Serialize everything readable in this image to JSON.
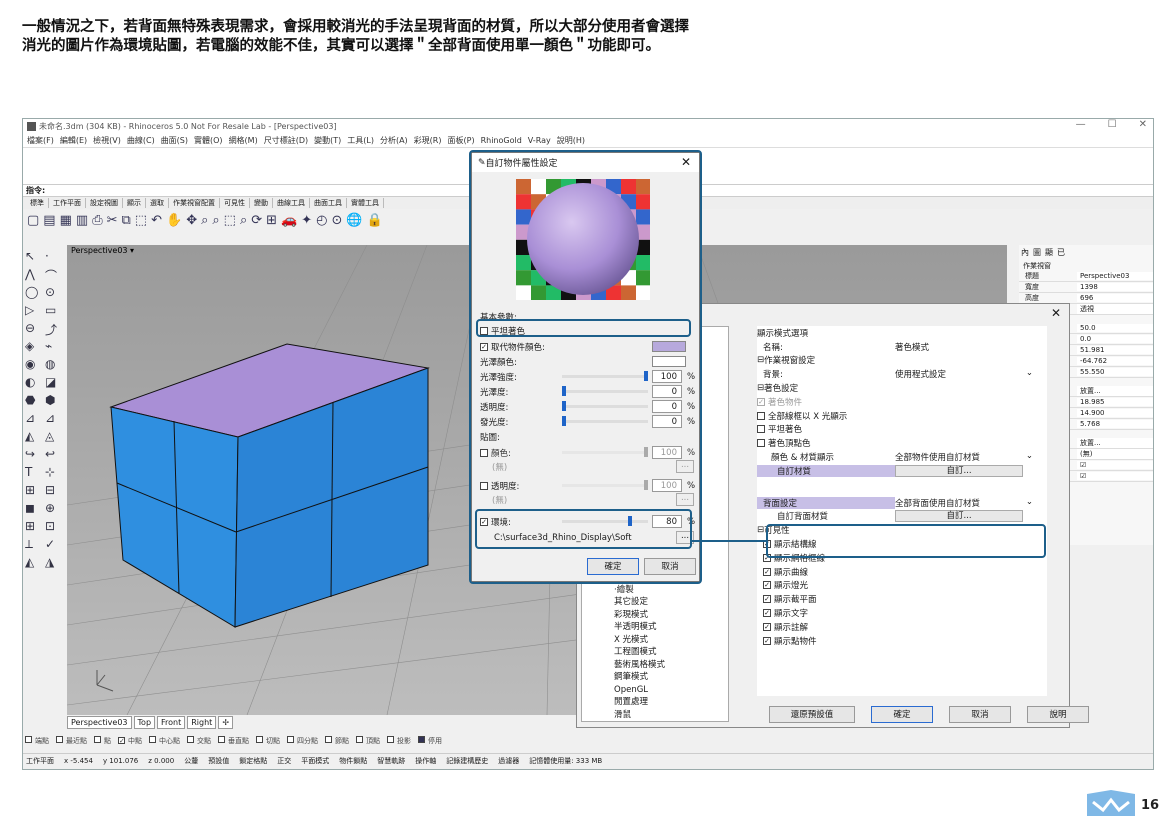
{
  "intro": {
    "line1": "一般情況之下，若背面無特殊表現需求，會採用較消光的手法呈現背面的材質，所以大部分使用者會選擇",
    "line2": "消光的圖片作為環境貼圖，若電腦的效能不佳，其實可以選擇＂全部背面使用單一顏色＂功能即可。"
  },
  "window": {
    "title": "未命名.3dm (304 KB) - Rhinoceros 5.0 Not For Resale Lab - [Perspective03]",
    "controls": [
      "—",
      "☐",
      "✕"
    ],
    "menus": [
      "檔案(F)",
      "編輯(E)",
      "檢視(V)",
      "曲線(C)",
      "曲面(S)",
      "實體(O)",
      "網格(M)",
      "尺寸標註(D)",
      "變動(T)",
      "工具(L)",
      "分析(A)",
      "彩現(R)",
      "面板(P)",
      "RhinoGold",
      "V-Ray",
      "說明(H)"
    ],
    "command_label": "指令:",
    "tool_tabs": [
      "標準",
      "工作平面",
      "設定視圖",
      "顯示",
      "選取",
      "作業視窗配置",
      "可見性",
      "變動",
      "曲線工具",
      "曲面工具",
      "實體工具"
    ],
    "toolbar_icons": [
      "▢",
      "▤",
      "▦",
      "▥",
      "⎙",
      "✂",
      "⧉",
      "⬚",
      "↶",
      "✋",
      "✥",
      "⌕",
      "⌕",
      "⬚",
      "⌕",
      "⟳",
      "⊞",
      "🚗",
      "✦",
      "◴",
      "⊙",
      "🌐",
      "🔒"
    ],
    "left_icons": [
      "↖",
      "·",
      "⋀",
      "⌒",
      "◯",
      "⊙",
      "▷",
      "▭",
      "⊖",
      "⤴",
      "◈",
      "⌁",
      "◉",
      "◍",
      "◐",
      "◪",
      "⬣",
      "⬢",
      "⊿",
      "⊿",
      "◭",
      "◬",
      "↪",
      "↩",
      "T",
      "⊹",
      "⊞",
      "⊟",
      "◼",
      "⊕",
      "⊞",
      "⊡",
      "⟂",
      "✓",
      "◭",
      "◮"
    ],
    "viewport_label": "Perspective03",
    "view_tabs": [
      "Perspective03",
      "Top",
      "Front",
      "Right",
      "✢"
    ],
    "osnaps": [
      "端點",
      "最近點",
      "點",
      "中點",
      "中心點",
      "交點",
      "垂直點",
      "切點",
      "四分點",
      "節點",
      "頂點",
      "投影",
      "停用"
    ],
    "status": [
      "工作平面",
      "x -5.454",
      "y 101.076",
      "z 0.000",
      "公釐",
      "預設值",
      "鎖定格點",
      "正交",
      "平面模式",
      "物件鎖點",
      "智慧軌跡",
      "操作軸",
      "記錄建構歷史",
      "過濾器",
      "記憶體使用量: 333 MB"
    ]
  },
  "props_panel": {
    "tabs": [
      "內",
      "圖",
      "顯",
      "已"
    ],
    "section": "作業視窗",
    "rows": [
      {
        "k": "標題",
        "v": "Perspective03"
      },
      {
        "k": "寬度",
        "v": "1398"
      },
      {
        "k": "高度",
        "v": "696"
      },
      {
        "k": "投影",
        "v": "透視"
      },
      {
        "k": "",
        "v": "50.0"
      },
      {
        "k": "",
        "v": "0.0"
      },
      {
        "k": "",
        "v": "51.981"
      },
      {
        "k": "",
        "v": "-64.762"
      },
      {
        "k": "",
        "v": "55.550"
      },
      {
        "k": "",
        "v": "放置..."
      },
      {
        "k": "",
        "v": "18.985"
      },
      {
        "k": "",
        "v": "14.900"
      },
      {
        "k": "",
        "v": "5.768"
      },
      {
        "k": "",
        "v": "放置..."
      },
      {
        "k": "",
        "v": "(無)"
      },
      {
        "k": "",
        "v": "☑"
      },
      {
        "k": "",
        "v": "☑"
      }
    ]
  },
  "dialog_material": {
    "title": "自訂物件屬性設定",
    "basic_params": "基本參數:",
    "flat_shading": "平坦著色",
    "override_color": "取代物件顏色:",
    "override_color_swatch": "#b7a9dc",
    "gloss_color": "光澤顏色:",
    "gloss_strength": {
      "label": "光澤強度:",
      "value": "100",
      "fraction": 1.0
    },
    "glossiness": {
      "label": "光澤度:",
      "value": "0",
      "fraction": 0.0
    },
    "transparency": {
      "label": "透明度:",
      "value": "0",
      "fraction": 0.0
    },
    "emission": {
      "label": "發光度:",
      "value": "0",
      "fraction": 0.0
    },
    "texture_section": "貼圖:",
    "color_tex": {
      "label": "顏色:",
      "value": "100",
      "none": "(無)"
    },
    "transp_tex": {
      "label": "透明度:",
      "value": "100",
      "none": "(無)"
    },
    "environment": {
      "label": "環境:",
      "value": "80",
      "fraction": 0.8,
      "path": "C:\\surface3d_Rhino_Display\\Soft"
    },
    "pct": "%",
    "dots": "...",
    "ok": "確定",
    "cancel": "取消"
  },
  "dialog_display": {
    "tree": [
      "",
      "",
      "",
      "",
      "",
      "",
      "",
      "",
      "",
      "",
      "",
      "",
      "",
      "",
      "",
      "",
      "",
      "",
      "",
      "",
      "",
      "",
      "",
      "",
      "",
      "",
      "",
      "",
      "",
      "",
      "",
      "",
      "·繪製",
      "其它設定",
      "彩現模式",
      "半透明模式",
      "X 光模式",
      "工程圖模式",
      "藝術風格模式",
      "鋼筆模式",
      "OpenGL",
      "閒置處理",
      "滑鼠"
    ],
    "mode_options": "顯示模式選項",
    "name_label": "名稱:",
    "name_value": "著色模式",
    "viewport_settings": "作業視窗設定",
    "background_label": "背景:",
    "background_value": "使用程式設定",
    "shading_settings": "著色設定",
    "shade_objects": "著色物件",
    "xray_all": "全部線框以 X 光顯示",
    "flat_shading": "平坦著色",
    "vertex_colors": "著色頂點色",
    "color_material": "顏色 & 材質顯示",
    "color_material_value": "全部物件使用自訂材質",
    "custom_material": "自訂材質",
    "custom_btn": "自訂...",
    "backface": "背面設定",
    "backface_value": "全部背面使用自訂材質",
    "custom_backface": "自訂背面材質",
    "visibility": "可見性",
    "vis_items": [
      "顯示結構線",
      "顯示網格框線",
      "顯示曲線",
      "顯示燈光",
      "顯示截平面",
      "顯示文字",
      "顯示註解",
      "顯示點物件"
    ],
    "restore": "還原預設值",
    "ok": "確定",
    "cancel": "取消",
    "help": "說明"
  },
  "page_number": "16",
  "colors": {
    "accent": "#1d5f8a",
    "box_blue": "#2f8fe0",
    "box_inner": "#a98fd6"
  }
}
